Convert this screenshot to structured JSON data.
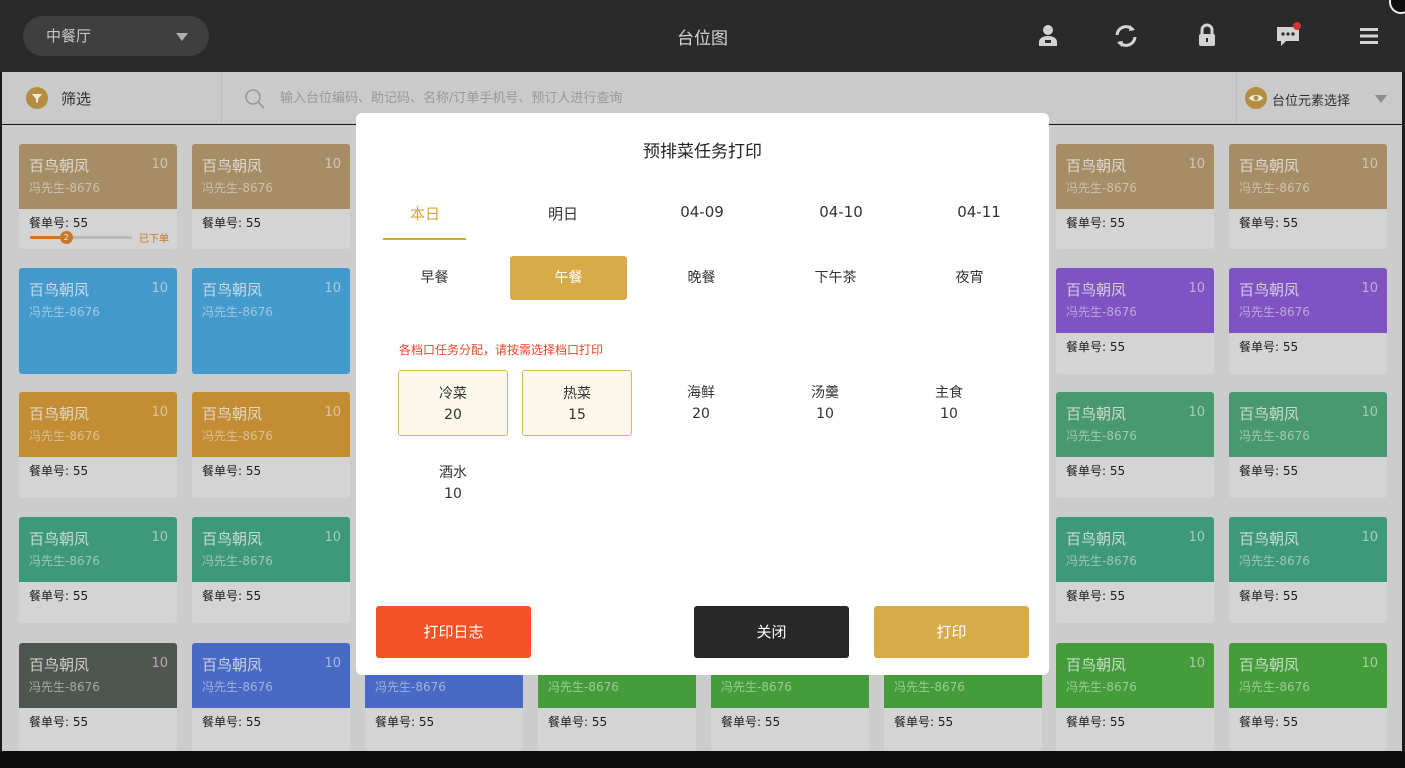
{
  "header": {
    "hall": "中餐厅",
    "title": "台位图",
    "icons": [
      "user-icon",
      "refresh-icon",
      "lock-icon",
      "message-icon",
      "menu-icon"
    ]
  },
  "filter": {
    "label": "筛选",
    "search_placeholder": "输入台位编码、助记码、名称/订单手机号、预订人进行查询",
    "element_select": "台位元素选择"
  },
  "cards": [
    {
      "name": "百鸟朝凤",
      "cap": "10",
      "phone": "冯先生-8676",
      "order": "餐单号: 55",
      "color": "#b59a6e",
      "progress": {
        "step": "2",
        "status": "已下单",
        "fraction": 0.35
      }
    },
    {
      "name": "百鸟朝凤",
      "cap": "10",
      "phone": "冯先生-8676",
      "order": "餐单号: 55",
      "color": "#b59a6e"
    },
    {
      "name": "百鸟朝凤",
      "cap": "10",
      "phone": "冯先生-8676",
      "order": "餐单号: 55",
      "color": "#b59a6e"
    },
    {
      "name": "百鸟朝凤",
      "cap": "10",
      "phone": "冯先生-8676",
      "order": "餐单号: 55",
      "color": "#b59a6e"
    },
    {
      "name": "百鸟朝凤",
      "cap": "10",
      "phone": "冯先生-8676",
      "order": "",
      "color": "#4aa8df"
    },
    {
      "name": "百鸟朝凤",
      "cap": "10",
      "phone": "冯先生-8676",
      "order": "",
      "color": "#4aa8df"
    },
    {
      "name": "百鸟朝凤",
      "cap": "10",
      "phone": "冯先生-8676",
      "order": "餐单号: 55",
      "color": "#8a5bd3"
    },
    {
      "name": "百鸟朝凤",
      "cap": "10",
      "phone": "冯先生-8676",
      "order": "餐单号: 55",
      "color": "#8a5bd3"
    },
    {
      "name": "百鸟朝凤",
      "cap": "10",
      "phone": "冯先生-8676",
      "order": "餐单号: 55",
      "color": "#d39a38"
    },
    {
      "name": "百鸟朝凤",
      "cap": "10",
      "phone": "冯先生-8676",
      "order": "餐单号: 55",
      "color": "#d39a38"
    },
    {
      "name": "百鸟朝凤",
      "cap": "10",
      "phone": "冯先生-8676",
      "order": "餐单号: 55",
      "color": "#4fa779"
    },
    {
      "name": "百鸟朝凤",
      "cap": "10",
      "phone": "冯先生-8676",
      "order": "餐单号: 55",
      "color": "#4fa779"
    },
    {
      "name": "百鸟朝凤",
      "cap": "10",
      "phone": "冯先生-8676",
      "order": "餐单号: 55",
      "color": "#44a786"
    },
    {
      "name": "百鸟朝凤",
      "cap": "10",
      "phone": "冯先生-8676",
      "order": "餐单号: 55",
      "color": "#44a786"
    },
    {
      "name": "百鸟朝凤",
      "cap": "10",
      "phone": "冯先生-8676",
      "order": "餐单号: 55",
      "color": "#44a786"
    },
    {
      "name": "百鸟朝凤",
      "cap": "10",
      "phone": "冯先生-8676",
      "order": "餐单号: 55",
      "color": "#44a786"
    },
    {
      "name": "百鸟朝凤",
      "cap": "10",
      "phone": "冯先生-8676",
      "order": "餐单号: 55",
      "color": "#565e58"
    },
    {
      "name": "百鸟朝凤",
      "cap": "10",
      "phone": "冯先生-8676",
      "order": "餐单号: 55",
      "color": "#4f73d6"
    },
    {
      "name": "",
      "cap": "",
      "phone": "冯先生-8676",
      "order": "餐单号: 55",
      "color": "#4f73d6"
    },
    {
      "name": "",
      "cap": "",
      "phone": "冯先生-8676",
      "order": "餐单号: 55",
      "color": "#4aaa40"
    },
    {
      "name": "",
      "cap": "",
      "phone": "冯先生-8676",
      "order": "餐单号: 55",
      "color": "#4aaa40"
    },
    {
      "name": "",
      "cap": "",
      "phone": "冯先生-8676",
      "order": "餐单号: 55",
      "color": "#4aaa40"
    },
    {
      "name": "百鸟朝凤",
      "cap": "10",
      "phone": "冯先生-8676",
      "order": "餐单号: 55",
      "color": "#4aaa40"
    },
    {
      "name": "百鸟朝凤",
      "cap": "10",
      "phone": "冯先生-8676",
      "order": "餐单号: 55",
      "color": "#4aaa40"
    }
  ],
  "modal": {
    "title": "预排菜任务打印",
    "date_tabs": [
      "本日",
      "明日",
      "04-09",
      "04-10",
      "04-11"
    ],
    "active_date": 0,
    "meals": [
      "早餐",
      "午餐",
      "晚餐",
      "下午茶",
      "夜宵"
    ],
    "active_meal": 1,
    "hint": "各档口任务分配，请按需选择档口打印",
    "stations": [
      {
        "name": "冷菜",
        "count": "20",
        "selected": true
      },
      {
        "name": "热菜",
        "count": "15",
        "selected": true
      },
      {
        "name": "海鲜",
        "count": "20",
        "selected": false
      },
      {
        "name": "汤羹",
        "count": "10",
        "selected": false
      },
      {
        "name": "主食",
        "count": "10",
        "selected": false
      },
      {
        "name": "酒水",
        "count": "10",
        "selected": false
      }
    ],
    "buttons": {
      "log": "打印日志",
      "close": "关闭",
      "print": "打印"
    }
  },
  "colors": {
    "accent": "#d6ab48",
    "danger": "#f25226",
    "dark": "#282828"
  }
}
